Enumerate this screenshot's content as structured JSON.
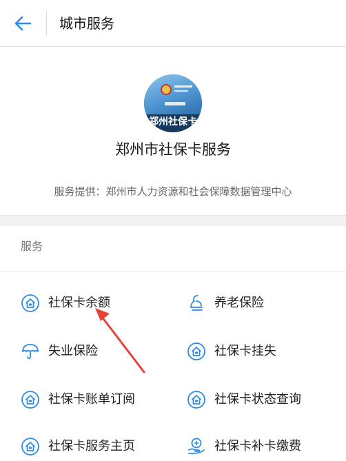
{
  "header": {
    "title": "城市服务"
  },
  "profile": {
    "logo_text": "郑州社保卡",
    "name": "郑州市社保卡服务",
    "provider": "服务提供：郑州市人力资源和社会保障数据管理中心"
  },
  "section": {
    "label": "服务"
  },
  "services": [
    {
      "label": "社保卡余额",
      "icon": "house-icon"
    },
    {
      "label": "养老保险",
      "icon": "person-icon"
    },
    {
      "label": "失业保险",
      "icon": "umbrella-icon"
    },
    {
      "label": "社保卡挂失",
      "icon": "house-icon"
    },
    {
      "label": "社保卡账单订阅",
      "icon": "house-icon"
    },
    {
      "label": "社保卡状态查询",
      "icon": "house-icon"
    },
    {
      "label": "社保卡服务主页",
      "icon": "house-icon"
    },
    {
      "label": "社保卡补卡缴费",
      "icon": "hand-coin-icon"
    }
  ],
  "colors": {
    "accent": "#2a8be8",
    "annotation_arrow": "#e8413a"
  }
}
